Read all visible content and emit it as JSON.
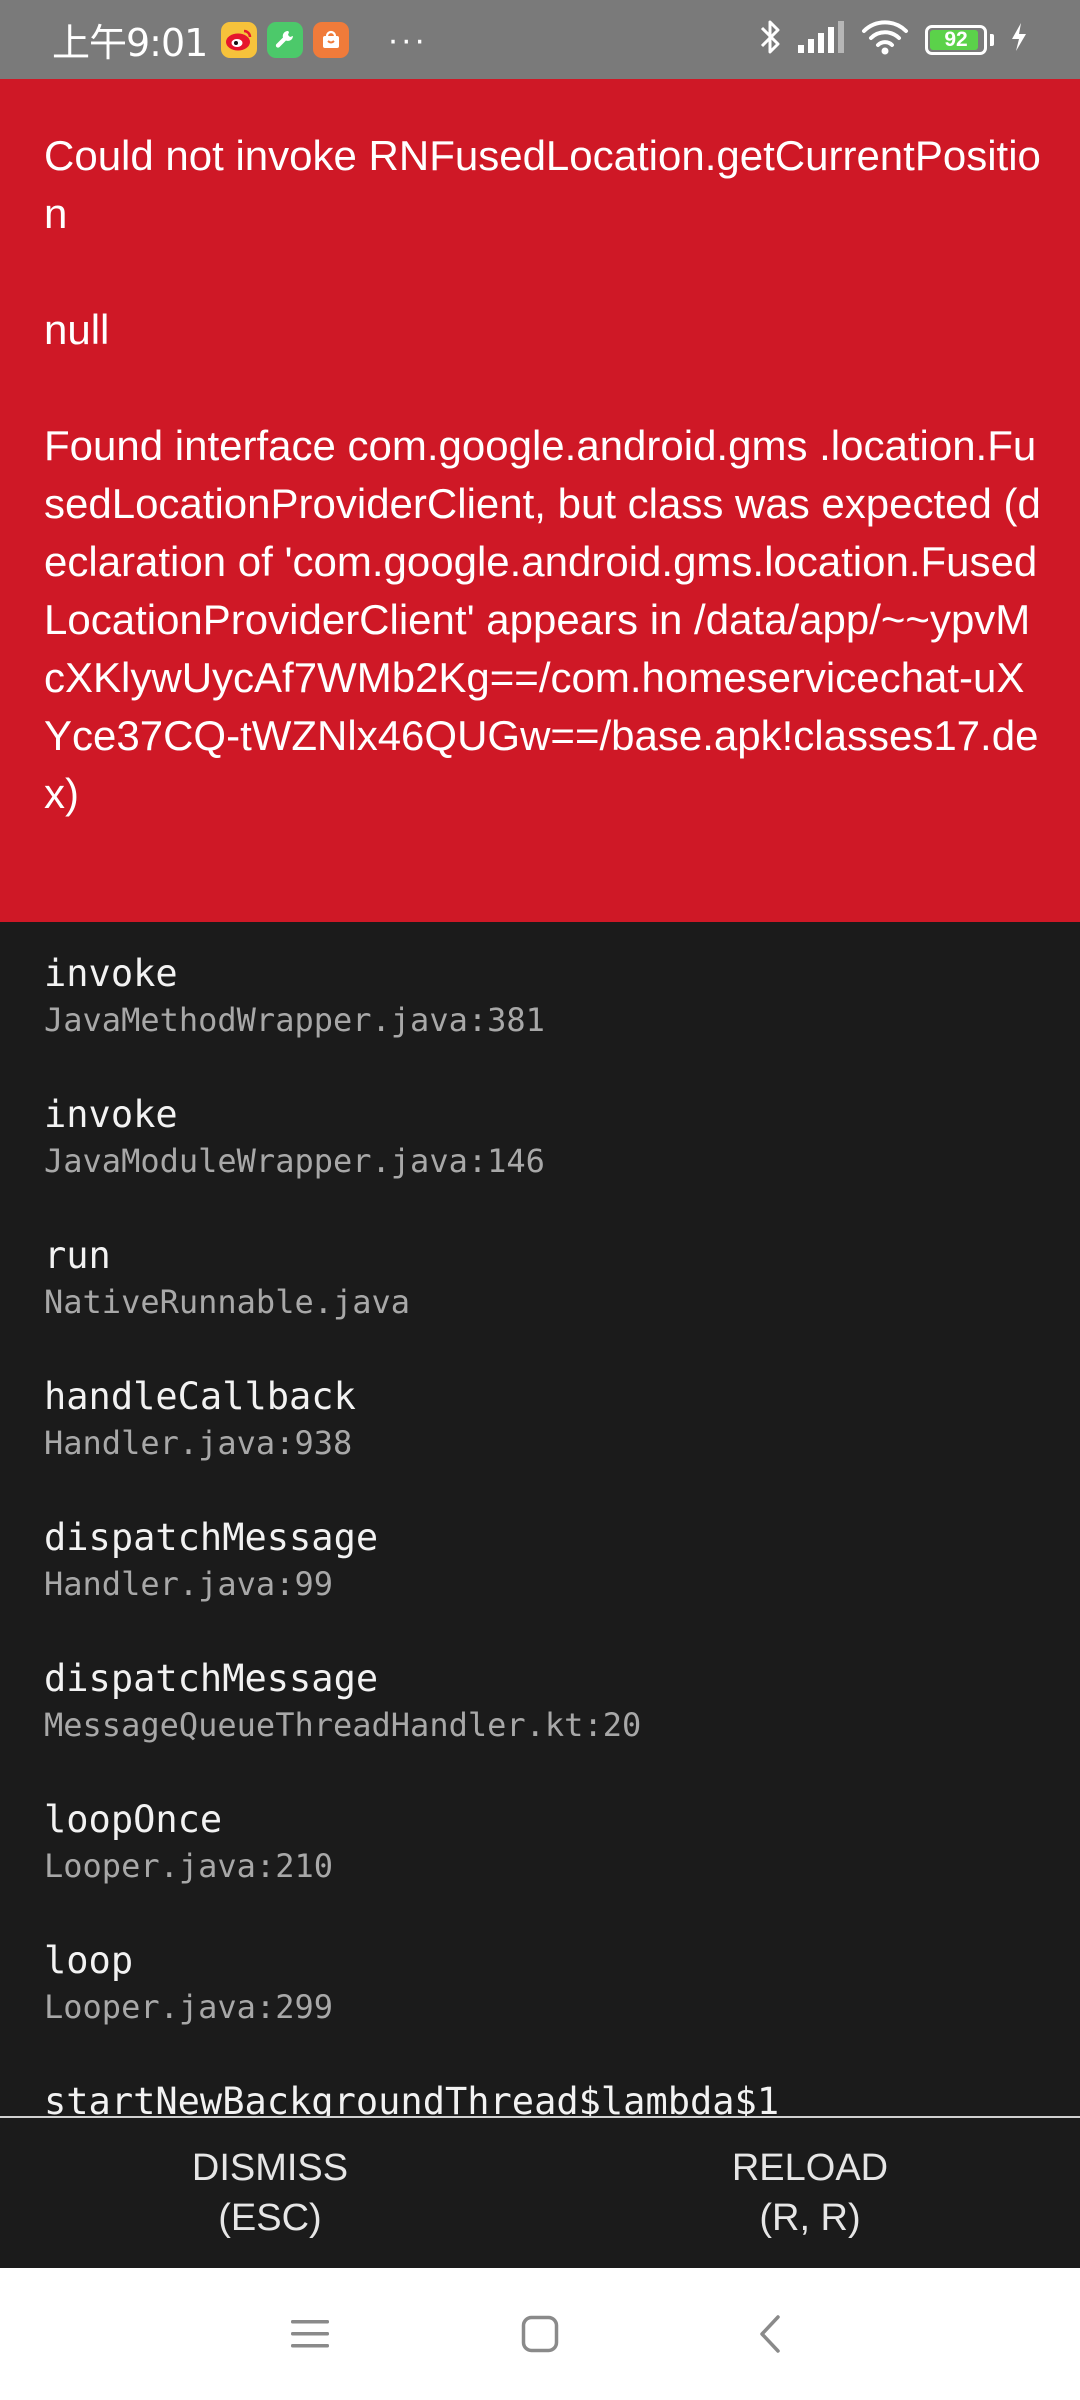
{
  "status_bar": {
    "time": "上午9:01",
    "notification_icons": [
      "weibo-icon",
      "tool-app-icon",
      "store-app-icon"
    ],
    "more_indicator": "···",
    "battery_level": "92",
    "battery_percent": 92,
    "charging": true,
    "system_icons": [
      "bluetooth-icon",
      "signal-icon",
      "wifi-icon",
      "battery-icon",
      "charging-icon"
    ]
  },
  "error": {
    "title": "Could not invoke RNFusedLocation.getCurrentPosition",
    "detail": "null",
    "message": "Found interface com.google.android.gms .location.FusedLocationProviderClient, but class was expected (declaration of 'com.google.android.gms.location.FusedLocationProviderClient' appears in /data/app/~~ypvMcXKlywUycAf7WMb2Kg==/com.homeservicechat-uXYce37CQ-tWZNlx46QUGw==/base.apk!classes17.dex)"
  },
  "stack": {
    "frames": [
      {
        "method": "invoke",
        "file": "JavaMethodWrapper.java:381"
      },
      {
        "method": "invoke",
        "file": "JavaModuleWrapper.java:146"
      },
      {
        "method": "run",
        "file": "NativeRunnable.java"
      },
      {
        "method": "handleCallback",
        "file": "Handler.java:938"
      },
      {
        "method": "dispatchMessage",
        "file": "Handler.java:99"
      },
      {
        "method": "dispatchMessage",
        "file": "MessageQueueThreadHandler.kt:20"
      },
      {
        "method": "loopOnce",
        "file": "Looper.java:210"
      },
      {
        "method": "loop",
        "file": "Looper.java:299"
      },
      {
        "method": "startNewBackgroundThread$lambda$1",
        "file": ""
      }
    ]
  },
  "footer": {
    "dismiss_label": "DISMISS",
    "dismiss_shortcut": "(ESC)",
    "reload_label": "RELOAD",
    "reload_shortcut": "(R, R)"
  },
  "nav_bar": {
    "icons": [
      "menu-icon",
      "home-icon",
      "back-icon"
    ]
  },
  "colors": {
    "status_bar_bg": "#7a7a7a",
    "error_red": "#cf1826",
    "stack_bg": "#1b1b1b",
    "method_text": "#f2f2f2",
    "file_text": "#a8a8a8",
    "battery_green": "#5bd24a"
  }
}
